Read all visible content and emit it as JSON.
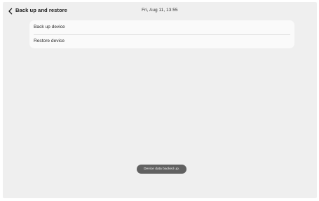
{
  "header": {
    "back_icon": "chevron-left-icon",
    "title": "Back up and restore",
    "datetime": "Fri, Aug 11, 13:55"
  },
  "menu": {
    "items": [
      {
        "label": "Back up device"
      },
      {
        "label": "Restore device"
      }
    ]
  },
  "toast": {
    "message": "Device data backed up."
  },
  "colors": {
    "background": "#efefef",
    "card": "#fafafa",
    "toast": "#616161"
  }
}
